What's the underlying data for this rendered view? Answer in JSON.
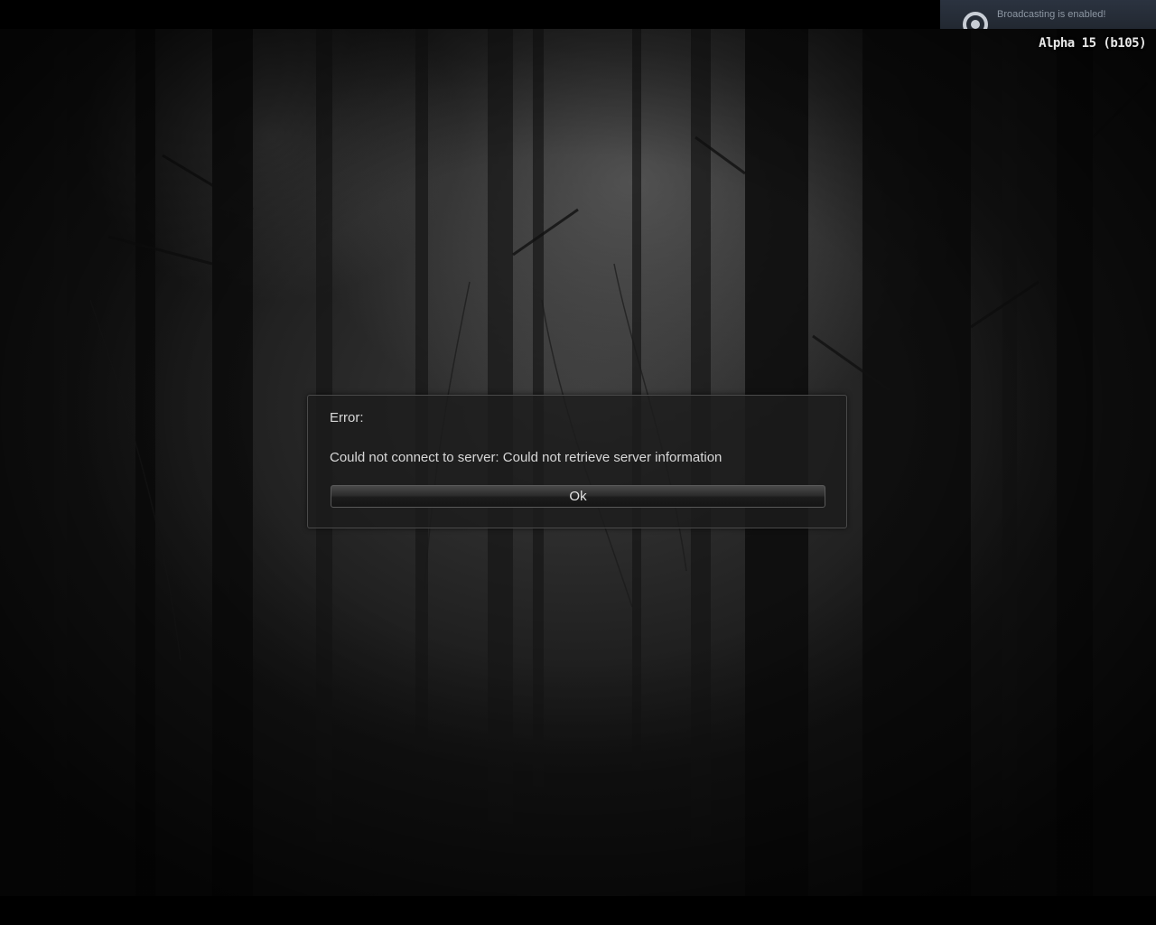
{
  "notification": {
    "text": "Broadcasting is enabled!",
    "icon": "broadcast-icon"
  },
  "version_label": "Alpha 15 (b105)",
  "dialog": {
    "title": "Error:",
    "message": "Could not connect to server: Could not retrieve server information",
    "ok_label": "Ok"
  },
  "colors": {
    "toast_background": "#262d37",
    "toast_text": "#8d97a3",
    "dialog_text": "#d8d8d8"
  }
}
